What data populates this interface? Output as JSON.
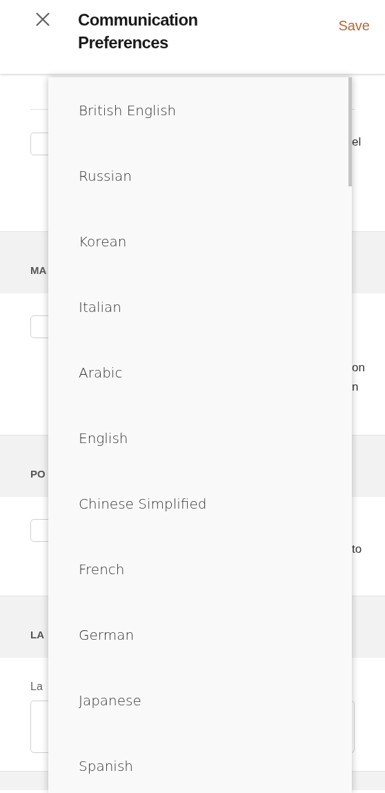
{
  "header": {
    "title": "Communication Preferences",
    "action": "Save"
  },
  "form": {
    "top_option": {
      "checked": false,
      "text": [
        "el"
      ]
    },
    "sections": [
      {
        "heading": "MA",
        "option": {
          "checked": false,
          "text": [
            "on",
            "n"
          ]
        }
      },
      {
        "heading": "PO",
        "option": {
          "checked": false,
          "text": [
            "to"
          ]
        }
      },
      {
        "heading": "LA",
        "field_label": "La"
      }
    ]
  },
  "dropdown": {
    "options": [
      {
        "label": "British English"
      },
      {
        "label": "Russian"
      },
      {
        "label": "Korean"
      },
      {
        "label": "Italian"
      },
      {
        "label": "Arabic"
      },
      {
        "label": "English"
      },
      {
        "label": "Chinese Simplified"
      },
      {
        "label": "French"
      },
      {
        "label": "German"
      },
      {
        "label": "Japanese"
      },
      {
        "label": "Spanish"
      }
    ]
  }
}
